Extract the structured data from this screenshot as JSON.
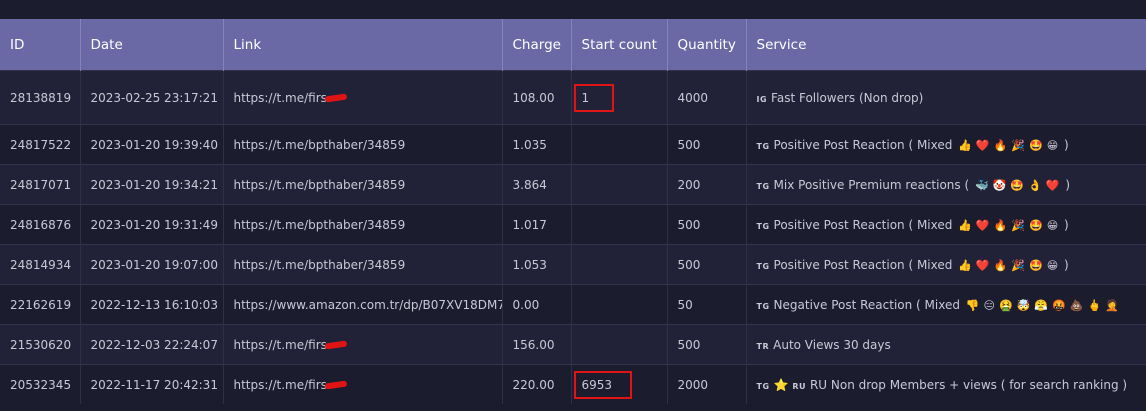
{
  "columns": [
    "ID",
    "Date",
    "Link",
    "Charge",
    "Start count",
    "Quantity",
    "Service"
  ],
  "rows": [
    {
      "id": "28138819",
      "date": "2023-02-25 23:17:21",
      "link": "https://t.me/firs",
      "charge": "108.00",
      "start": "1",
      "qty": "4000",
      "service_tag": "IG",
      "service": "Fast Followers (Non drop)"
    },
    {
      "id": "24817522",
      "date": "2023-01-20 19:39:40",
      "link": "https://t.me/bpthaber/34859",
      "charge": "1.035",
      "start": "",
      "qty": "500",
      "service_tag": "TG",
      "service": "Positive Post Reaction ( Mixed",
      "service_end": ")"
    },
    {
      "id": "24817071",
      "date": "2023-01-20 19:34:21",
      "link": "https://t.me/bpthaber/34859",
      "charge": "3.864",
      "start": "",
      "qty": "200",
      "service_tag": "TG",
      "service": "Mix Positive Premium reactions (",
      "service_end": ")"
    },
    {
      "id": "24816876",
      "date": "2023-01-20 19:31:49",
      "link": "https://t.me/bpthaber/34859",
      "charge": "1.017",
      "start": "",
      "qty": "500",
      "service_tag": "TG",
      "service": "Positive Post Reaction ( Mixed",
      "service_end": ")"
    },
    {
      "id": "24814934",
      "date": "2023-01-20 19:07:00",
      "link": "https://t.me/bpthaber/34859",
      "charge": "1.053",
      "start": "",
      "qty": "500",
      "service_tag": "TG",
      "service": "Positive Post Reaction ( Mixed",
      "service_end": ")"
    },
    {
      "id": "22162619",
      "date": "2022-12-13 16:10:03",
      "link": "https://www.amazon.com.tr/dp/B07XV18DM7",
      "charge": "0.00",
      "start": "",
      "qty": "50",
      "service_tag": "TG",
      "service": "Negative Post Reaction ( Mixed"
    },
    {
      "id": "21530620",
      "date": "2022-12-03 22:24:07",
      "link": "https://t.me/firs",
      "charge": "156.00",
      "start": "",
      "qty": "500",
      "service_tag": "TR",
      "service": "Auto Views 30 days"
    },
    {
      "id": "20532345",
      "date": "2022-11-17 20:42:31",
      "link": "https://t.me/firs",
      "charge": "220.00",
      "start": "6953",
      "qty": "2000",
      "service_tag": "TG",
      "service_tag2": "RU",
      "service": "RU Non drop Members + views ( for search ranking )"
    }
  ],
  "emoji_sets": {
    "positive": [
      "👍",
      "❤️",
      "🔥",
      "🎉",
      "🤩",
      "😁"
    ],
    "premium": [
      "🐳",
      "🤡",
      "🤩",
      "👌",
      "❤️"
    ],
    "negative": [
      "👎",
      "😑",
      "🤮",
      "🤯",
      "😤",
      "🤬",
      "💩",
      "🖕",
      "🤦"
    ],
    "star": "⭐"
  },
  "colors": {
    "header_bg": "#6a69a6",
    "row_bg": "#212237",
    "annotation": "#e01414"
  }
}
